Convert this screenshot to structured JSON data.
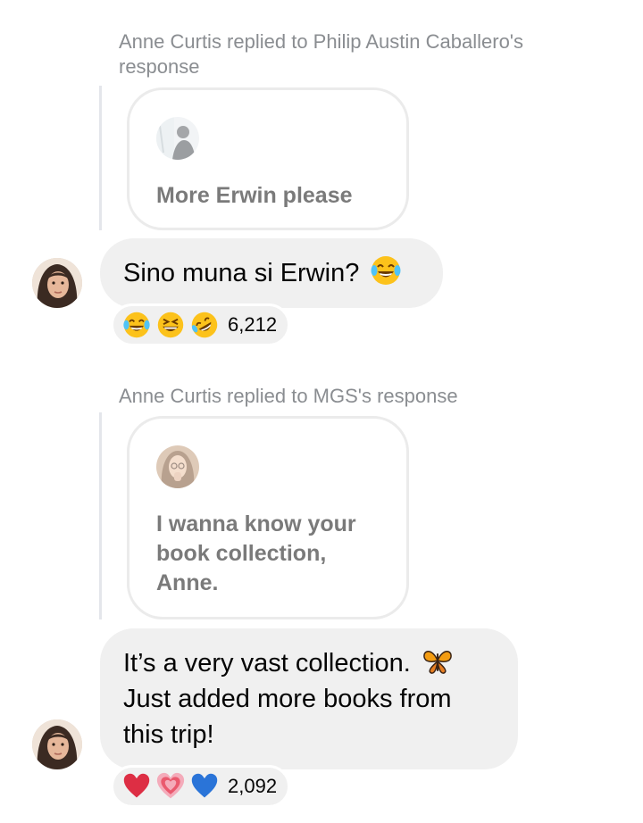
{
  "thread1": {
    "header": "Anne Curtis replied to Philip Austin Caballero's response",
    "quote_text": "More Erwin please",
    "reply_text": "Sino muna si Erwin?",
    "reply_emoji": "laughing-tears-icon",
    "reactions": [
      "laughing-tears-icon",
      "grinning-squint-icon",
      "rofl-icon"
    ],
    "reaction_count": "6,212"
  },
  "thread2": {
    "header": "Anne Curtis replied to MGS's response",
    "quote_text": "I wanna know your book collection, Anne.",
    "reply_line1": "It’s a very vast collection.",
    "reply_line2": "Just added more books from",
    "reply_line3": "this trip!",
    "reply_emoji": "butterfly-icon",
    "reactions": [
      "red-heart-icon",
      "growing-heart-icon",
      "blue-heart-icon"
    ],
    "reaction_count": "2,092"
  },
  "colors": {
    "bubble_bg": "#f0f0f0",
    "header_text": "#8a8d91",
    "quote_text": "#7a7a7a"
  }
}
